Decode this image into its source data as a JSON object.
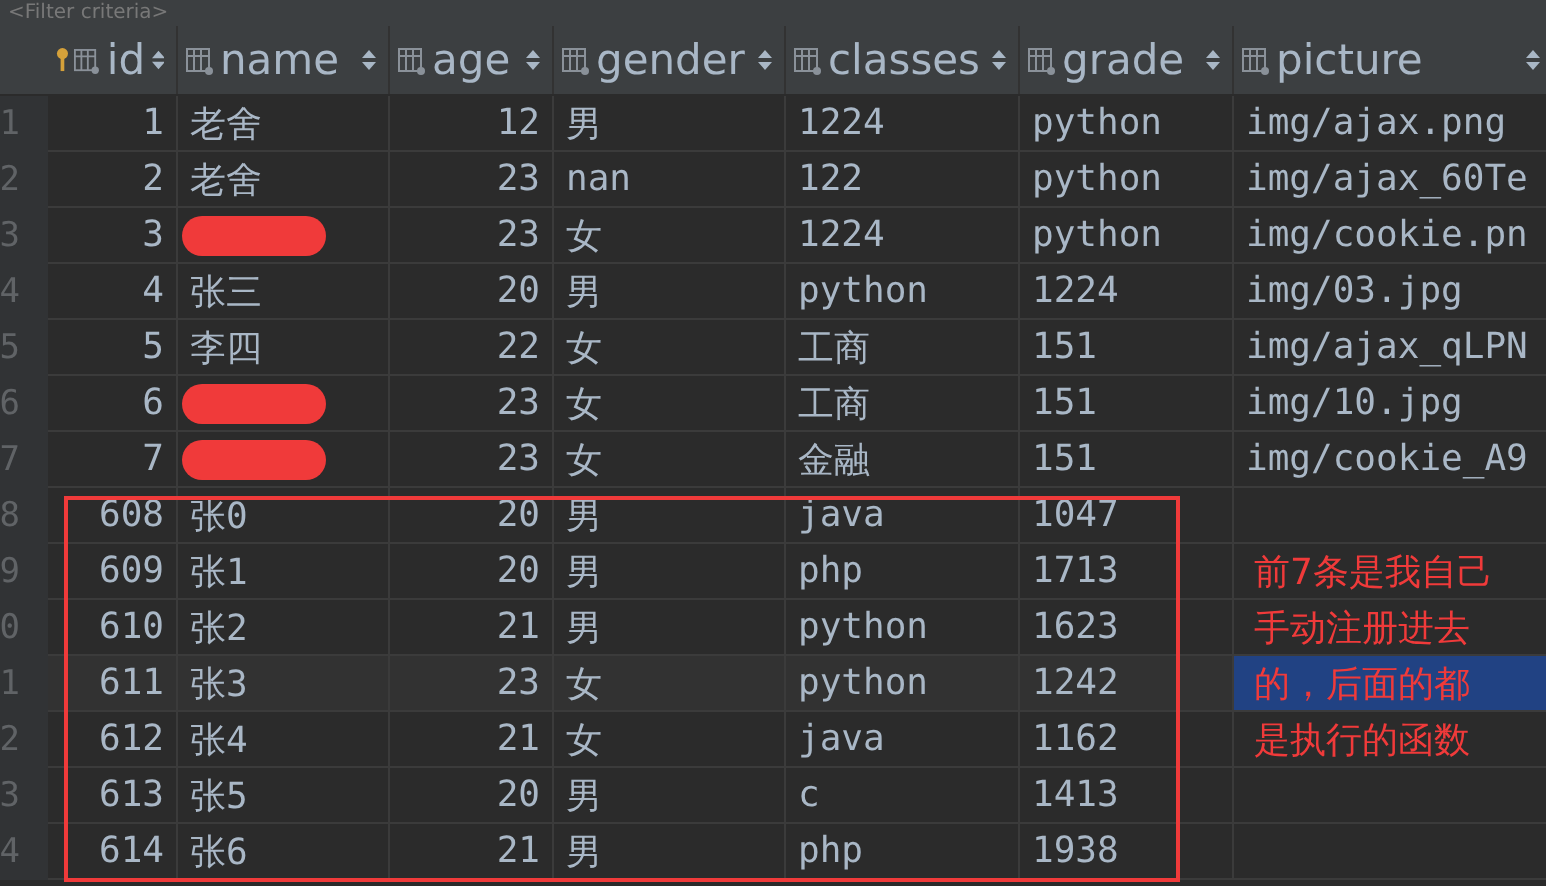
{
  "filter": {
    "placeholder": "<Filter criteria>"
  },
  "columns": [
    {
      "label": "id",
      "key": true
    },
    {
      "label": "name",
      "key": false
    },
    {
      "label": "age",
      "key": false
    },
    {
      "label": "gender",
      "key": false
    },
    {
      "label": "classes",
      "key": false
    },
    {
      "label": "grade",
      "key": false
    },
    {
      "label": "picture",
      "key": false
    }
  ],
  "rows": [
    {
      "gutter": "1",
      "selected": false,
      "redacted": false,
      "cells": [
        "1",
        "老舍",
        "12",
        "男",
        "1224",
        "python",
        "img/ajax.png"
      ]
    },
    {
      "gutter": "2",
      "selected": false,
      "redacted": false,
      "cells": [
        "2",
        "老舍",
        "23",
        "nan",
        "122",
        "python",
        "img/ajax_60Te"
      ]
    },
    {
      "gutter": "3",
      "selected": false,
      "redacted": true,
      "cells": [
        "3",
        "",
        "23",
        "女",
        "1224",
        "python",
        "img/cookie.pn"
      ]
    },
    {
      "gutter": "4",
      "selected": false,
      "redacted": false,
      "cells": [
        "4",
        "张三",
        "20",
        "男",
        "python",
        "1224",
        "img/03.jpg"
      ]
    },
    {
      "gutter": "5",
      "selected": false,
      "redacted": false,
      "cells": [
        "5",
        "李四",
        "22",
        "女",
        "工商",
        "151",
        "img/ajax_qLPN"
      ]
    },
    {
      "gutter": "6",
      "selected": false,
      "redacted": true,
      "cells": [
        "6",
        "",
        "23",
        "女",
        "工商",
        "151",
        "img/10.jpg"
      ]
    },
    {
      "gutter": "7",
      "selected": false,
      "redacted": true,
      "cells": [
        "7",
        "",
        "23",
        "女",
        "金融",
        "151",
        "img/cookie_A9"
      ]
    },
    {
      "gutter": "8",
      "selected": false,
      "redacted": false,
      "cells": [
        "608",
        "张0",
        "20",
        "男",
        "java",
        "1047",
        ""
      ]
    },
    {
      "gutter": "9",
      "selected": false,
      "redacted": false,
      "note": "前7条是我自己",
      "cells": [
        "609",
        "张1",
        "20",
        "男",
        "php",
        "1713",
        ""
      ]
    },
    {
      "gutter": "0",
      "selected": false,
      "redacted": false,
      "note": "手动注册进去",
      "cells": [
        "610",
        "张2",
        "21",
        "男",
        "python",
        "1623",
        ""
      ]
    },
    {
      "gutter": "1",
      "selected": true,
      "redacted": false,
      "note": "的，后面的都",
      "cells": [
        "611",
        "张3",
        "23",
        "女",
        "python",
        "1242",
        ""
      ]
    },
    {
      "gutter": "2",
      "selected": false,
      "redacted": false,
      "note": "是执行的函数",
      "cells": [
        "612",
        "张4",
        "21",
        "女",
        "java",
        "1162",
        ""
      ]
    },
    {
      "gutter": "3",
      "selected": false,
      "redacted": false,
      "cells": [
        "613",
        "张5",
        "20",
        "男",
        "c",
        "1413",
        ""
      ]
    },
    {
      "gutter": "4",
      "selected": false,
      "redacted": false,
      "cells": [
        "614",
        "张6",
        "21",
        "男",
        "php",
        "1938",
        ""
      ]
    }
  ]
}
